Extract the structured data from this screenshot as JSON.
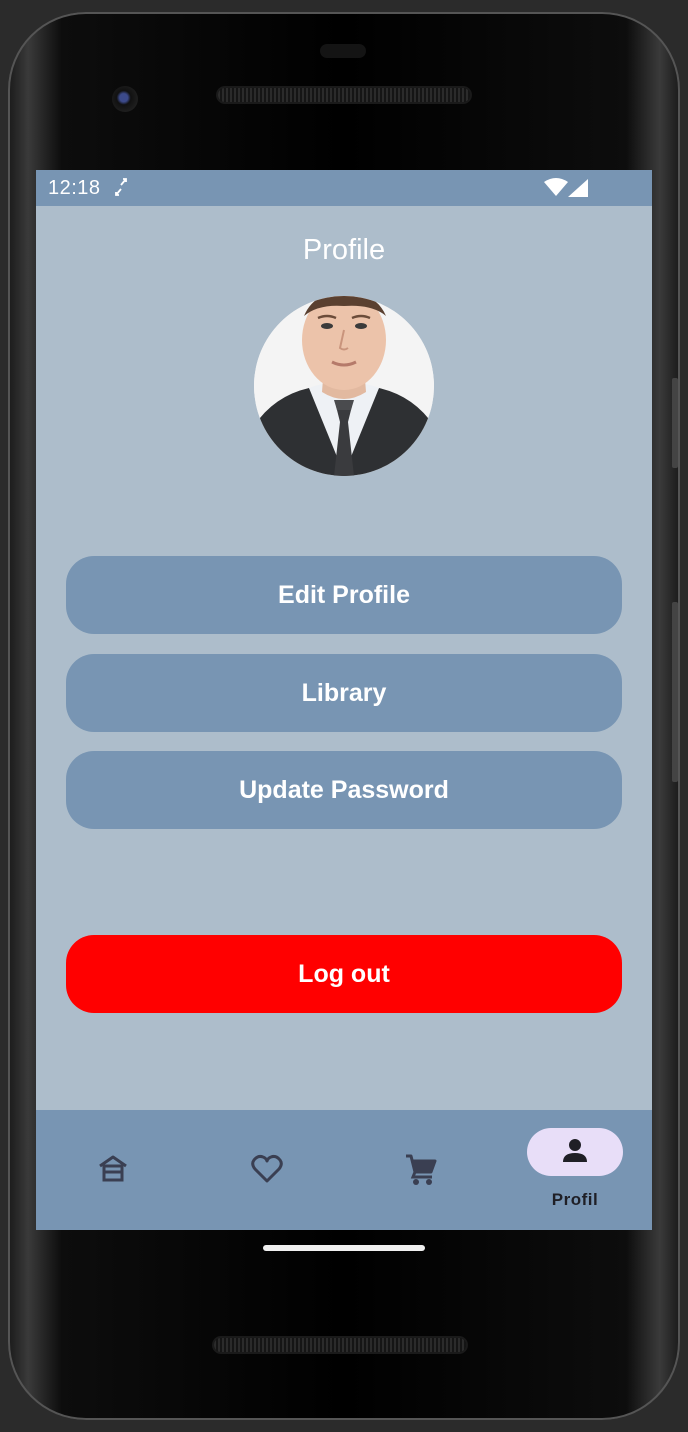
{
  "status_bar": {
    "time": "12:18",
    "icons": [
      "sync-icon",
      "wifi-icon",
      "signal-icon"
    ]
  },
  "header": {
    "title": "Profile"
  },
  "profile": {
    "avatar": "profile-photo"
  },
  "menu": {
    "edit_profile": "Edit Profile",
    "library": "Library",
    "update_password": "Update Password",
    "logout": "Log out"
  },
  "bottom_nav": {
    "items": [
      {
        "icon": "home-icon",
        "label": ""
      },
      {
        "icon": "heart-icon",
        "label": ""
      },
      {
        "icon": "cart-icon",
        "label": ""
      },
      {
        "icon": "person-icon",
        "label": "Profil",
        "active": true
      }
    ]
  },
  "colors": {
    "background": "#adbdcb",
    "accent": "#7895b3",
    "logout": "#ff0000",
    "active_pill": "#e8def8"
  }
}
